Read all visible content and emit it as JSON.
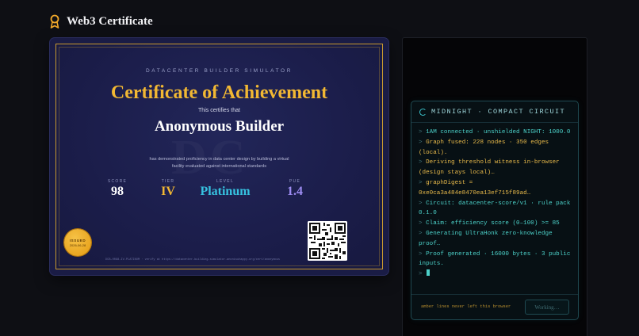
{
  "header": {
    "title": "Web3 Certificate",
    "icon": "ribbon-icon"
  },
  "certificate": {
    "kicker": "DATACENTER BUILDER SIMULATOR",
    "heading": "Certificate of Achievement",
    "certifies": "This certifies that",
    "recipient": "Anonymous Builder",
    "description": "has demonstrated proficiency in data center design by building a virtual facility evaluated against international standards",
    "stats": [
      {
        "label": "SCORE",
        "value": "98",
        "color": "#ffffff"
      },
      {
        "label": "TIER",
        "value": "IV",
        "color": "#f2b833"
      },
      {
        "label": "LEVEL",
        "value": "Platinum",
        "color": "#36c2e0"
      },
      {
        "label": "PUE",
        "value": "1.4",
        "color": "#9d8cf2"
      }
    ],
    "badge": {
      "line1": "ISSUED",
      "line2": "2026-06-28"
    },
    "verify_text": "DCB-0098-IV-PLATINUM · verify at https://datacenter-building-simulator.anonisuhappy.org/cert/anonymous",
    "accent_color": "#f2b833",
    "border_color": "#c99a2e"
  },
  "terminal": {
    "title": "MIDNIGHT · COMPACT CIRCUIT",
    "lines": [
      {
        "text": "1AM connected · unshielded NIGHT: 1000.0",
        "amber": false
      },
      {
        "text": "Graph fused: 228 nodes · 350 edges (local).",
        "amber": true
      },
      {
        "text": "Deriving threshold witness in-browser (design stays local)…",
        "amber": true
      },
      {
        "text": "graphDigest = 0xe0ca3a484e8470ea13ef715f89ad…",
        "amber": true
      },
      {
        "text": "Circuit: datacenter-score/v1 · rule pack 0.1.0",
        "amber": false
      },
      {
        "text": "Claim: efficiency score (0–100) >= 85",
        "amber": false
      },
      {
        "text": "Generating UltraHonk zero-knowledge proof…",
        "amber": false
      },
      {
        "text": "Proof generated · 16000 bytes · 3 public inputs.",
        "amber": false
      }
    ],
    "prompt": ">",
    "footer_note": "amber lines never left this browser",
    "button_label": "Working…",
    "colors": {
      "teal": "#4cd1c9",
      "amber": "#e6b84a"
    }
  }
}
